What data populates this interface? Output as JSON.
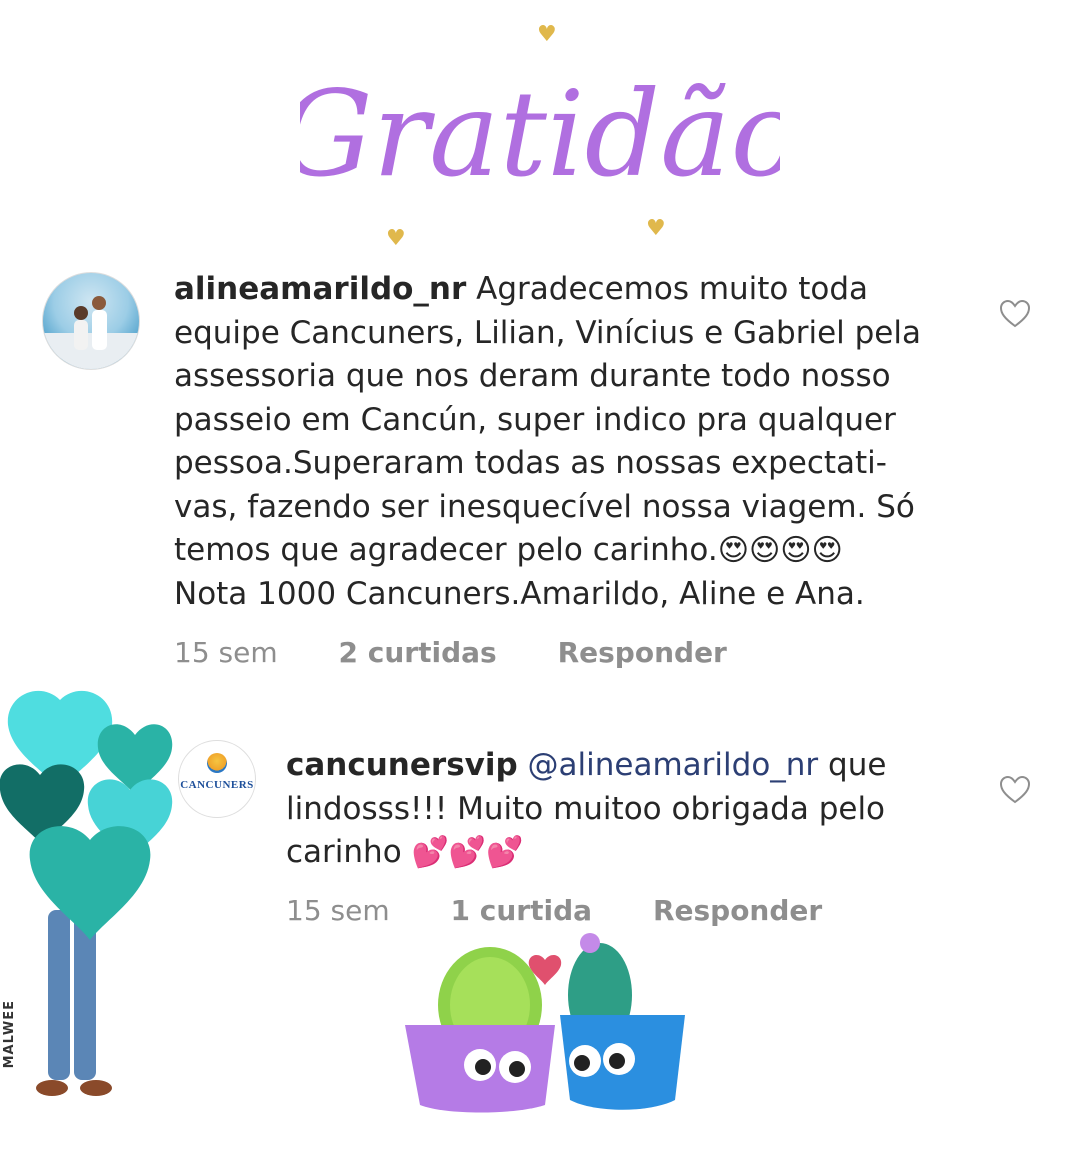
{
  "header": {
    "title": "Gratidão"
  },
  "comments": [
    {
      "username": "alineamarildo_nr",
      "text_lines": [
        "Agradecemos muito toda",
        "equipe Cancuners, Lilian, Vinícius e Gabriel pela",
        "assessoria que nos deram durante todo nosso",
        "passeio em Cancún, super indico pra qualquer",
        "pessoa.Superaram todas as nossas expectati-",
        "vas, fazendo ser inesquecível nossa viagem. Só",
        "temos que agradecer pelo carinho.",
        "Nota 1000 Cancuners.Amarildo, Aline e Ana."
      ],
      "emoji": "😍😍😍😍",
      "time": "15 sem",
      "likes": "2 curtidas",
      "reply": "Responder",
      "avatar_icon": "user-photo-avatar",
      "like_icon": "heart-outline-icon"
    },
    {
      "username": "cancunersvip",
      "mention": "@alineamarildo_nr",
      "text_lines": [
        "que",
        "lindosss!!! Muito muitoo obrigada pelo",
        "carinho"
      ],
      "emoji": "💕💕💕",
      "time": "15 sem",
      "likes": "1 curtida",
      "reply": "Responder",
      "avatar_logo_text": "CANCUNERS",
      "like_icon": "heart-outline-icon"
    }
  ],
  "decor": {
    "watermark": "MALWEE"
  },
  "colors": {
    "title_purple": "#b06fe0",
    "text": "#262626",
    "meta": "#8e8e8e",
    "mention": "#2c3f74",
    "teal": "#2ab3a6"
  }
}
